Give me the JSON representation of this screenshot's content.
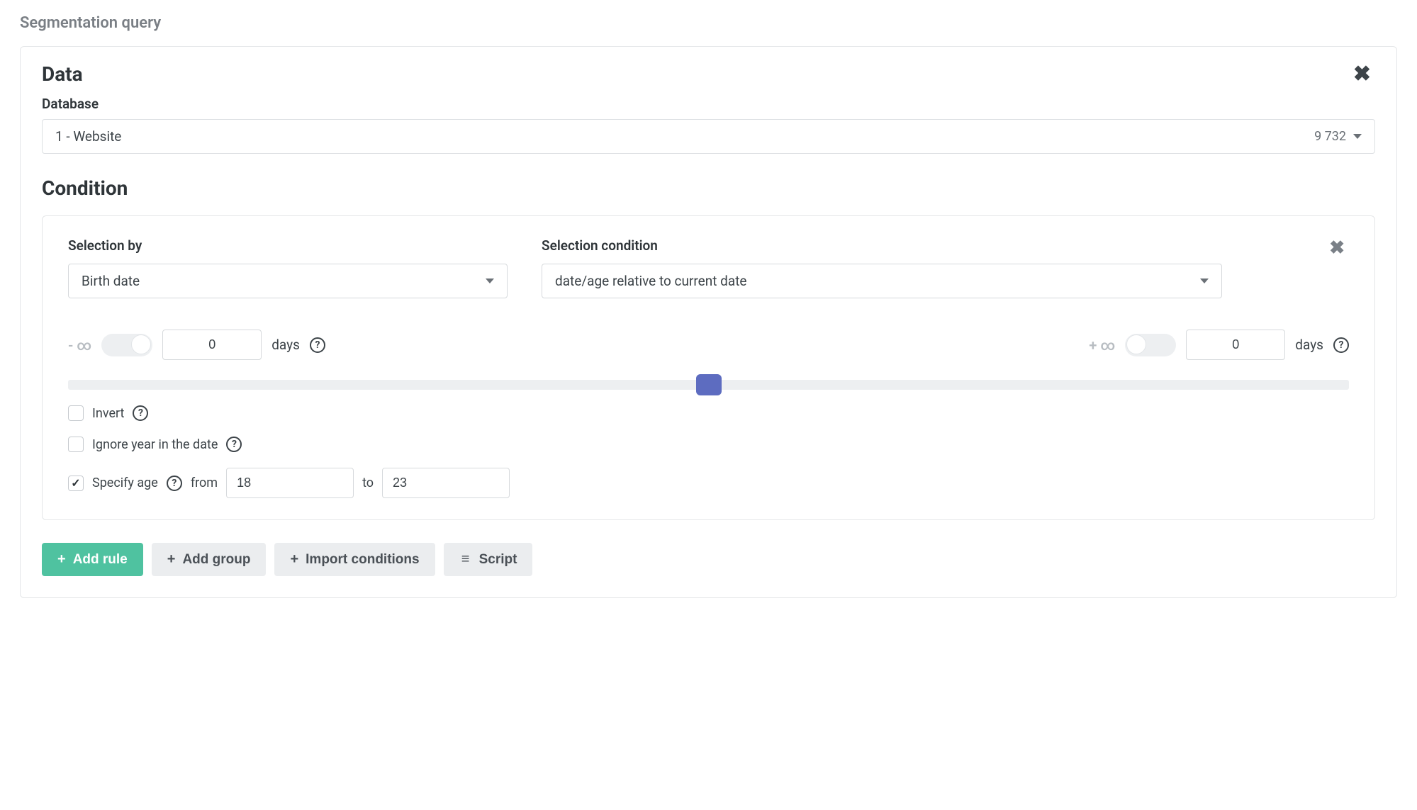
{
  "page": {
    "title": "Segmentation query"
  },
  "data_section": {
    "heading": "Data",
    "database_label": "Database",
    "database_value": "1 - Website",
    "database_count": "9 732"
  },
  "condition_section": {
    "heading": "Condition",
    "selection_by_label": "Selection by",
    "selection_by_value": "Birth date",
    "selection_condition_label": "Selection condition",
    "selection_condition_value": "date/age relative to current date",
    "range": {
      "minus_inf": "- ∞",
      "plus_inf": "+ ∞",
      "left_value": "0",
      "right_value": "0",
      "days_label_left": "days",
      "days_label_right": "days"
    },
    "invert_label": "Invert",
    "ignore_year_label": "Ignore year in the date",
    "specify_age": {
      "label": "Specify age",
      "from_label": "from",
      "from_value": "18",
      "to_label": "to",
      "to_value": "23"
    }
  },
  "buttons": {
    "add_rule": "Add rule",
    "add_group": "Add group",
    "import_conditions": "Import conditions",
    "script": "Script"
  }
}
